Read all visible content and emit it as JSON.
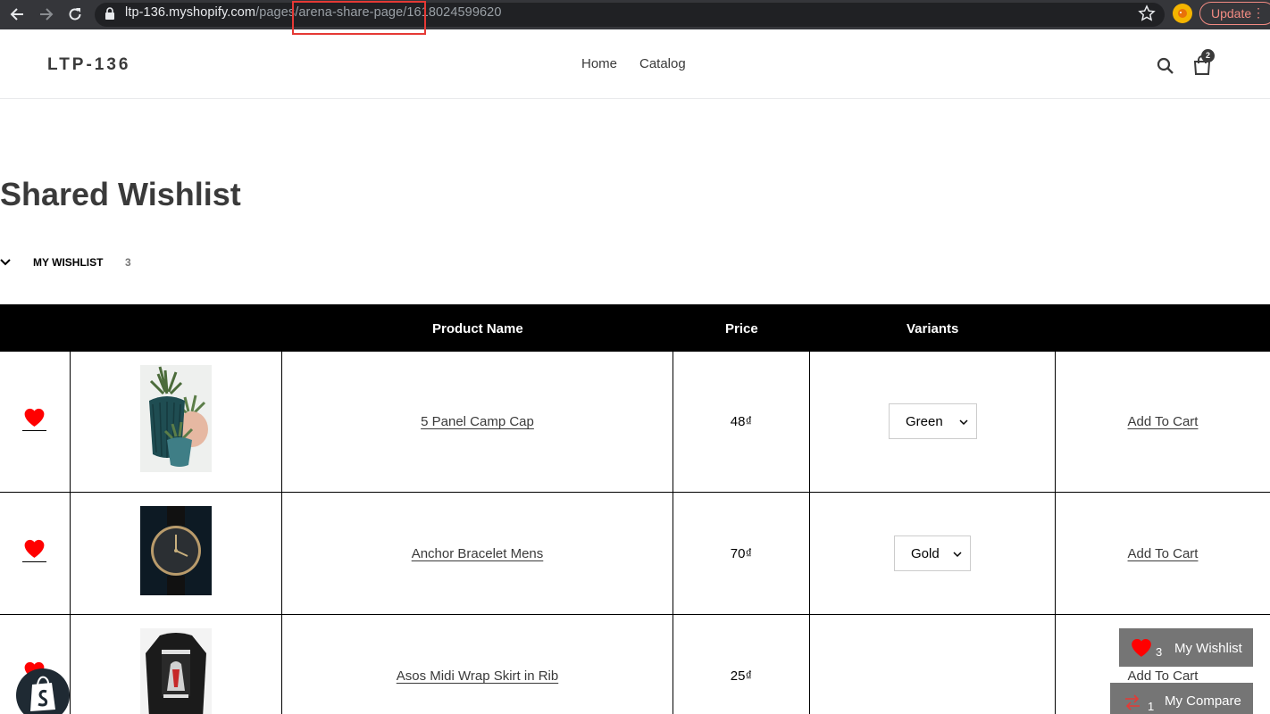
{
  "browser": {
    "url_host": "ltp-136.myshopify.com",
    "url_path": "/pages/arena-share-page/1618024599620",
    "update_label": "Update",
    "icons": [
      "back-arrow-icon",
      "forward-arrow-icon",
      "reload-icon",
      "lock-icon",
      "star-icon",
      "profile-icon",
      "kebab-menu-icon"
    ]
  },
  "header": {
    "logo": "LTP-136",
    "nav": [
      "Home",
      "Catalog"
    ],
    "cart_count": "2"
  },
  "page": {
    "title": "Shared Wishlist",
    "wishlist_label": "MY WISHLIST",
    "wishlist_count": "3"
  },
  "table": {
    "headers": [
      "",
      "",
      "Product Name",
      "Price",
      "Variants",
      ""
    ],
    "rows": [
      {
        "name": "5 Panel Camp Cap",
        "price": "48₫",
        "variant": "Green",
        "action": "Add To Cart",
        "image": "succulent-pots"
      },
      {
        "name": "Anchor Bracelet Mens",
        "price": "70₫",
        "variant": "Gold",
        "action": "Add To Cart",
        "image": "watch"
      },
      {
        "name": "Asos Midi Wrap Skirt in Rib",
        "price": "25₫",
        "variant": "",
        "action": "Add To Cart",
        "image": "black-sweater"
      }
    ]
  },
  "floating": {
    "wishlist_count": "3",
    "wishlist_label": "My Wishlist",
    "compare_count": "1",
    "compare_label": "My Compare"
  },
  "colors": {
    "heart": "#ff0000",
    "table_header_bg": "#000000",
    "float_bg": "#757575",
    "update_accent": "#f28b82"
  }
}
